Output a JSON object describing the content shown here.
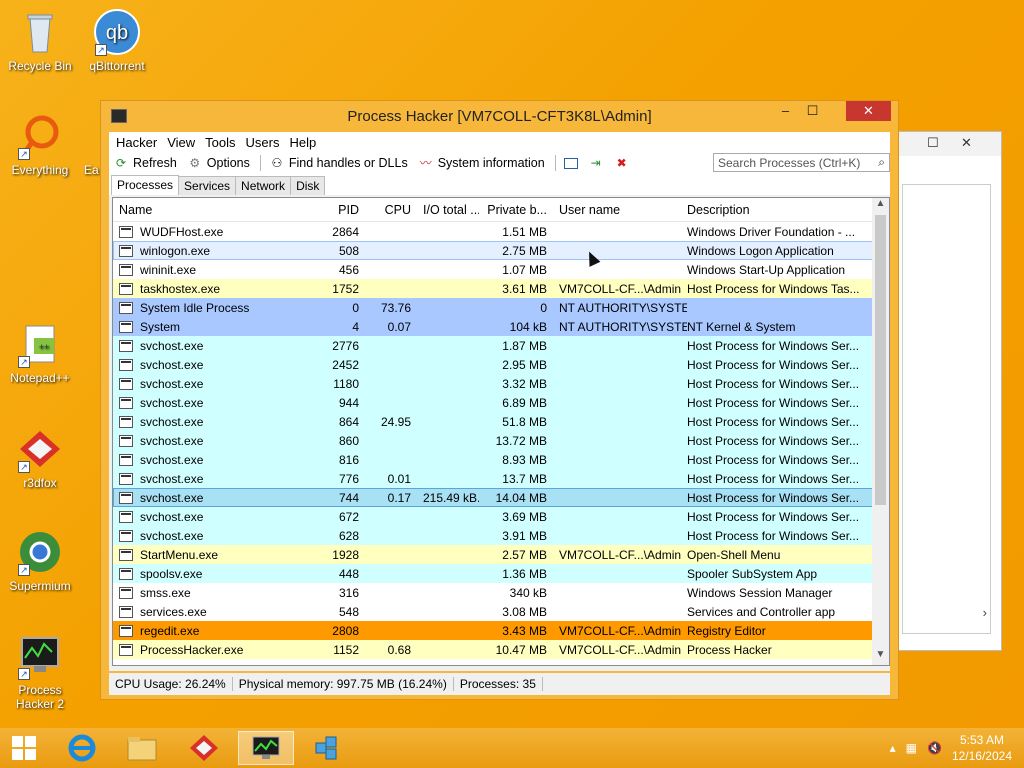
{
  "desktop": {
    "icons": [
      {
        "label": "Recycle Bin"
      },
      {
        "label": "qBittorrent"
      },
      {
        "label": "Everything"
      },
      {
        "label": "Ea"
      },
      {
        "label": "Notepad++"
      },
      {
        "label": "r3dfox"
      },
      {
        "label": "Supermium"
      },
      {
        "label": "Process Hacker 2"
      }
    ]
  },
  "window": {
    "title": "Process Hacker [VM7COLL-CFT3K8L\\Admin]",
    "menu": [
      "Hacker",
      "View",
      "Tools",
      "Users",
      "Help"
    ],
    "toolbar": {
      "refresh": "Refresh",
      "options": "Options",
      "find_handles": "Find handles or DLLs",
      "system_info": "System information"
    },
    "search_placeholder": "Search Processes (Ctrl+K)",
    "tabs": [
      "Processes",
      "Services",
      "Network",
      "Disk"
    ],
    "columns": [
      "Name",
      "PID",
      "CPU",
      "I/O total ...",
      "Private b...",
      "User name",
      "Description"
    ],
    "rows": [
      {
        "name": "WUDFHost.exe",
        "pid": "2864",
        "cpu": "",
        "io": "",
        "priv": "1.51 MB",
        "user": "",
        "desc": "Windows Driver Foundation - ...",
        "type": "normal"
      },
      {
        "name": "winlogon.exe",
        "pid": "508",
        "cpu": "",
        "io": "",
        "priv": "2.75 MB",
        "user": "",
        "desc": "Windows Logon Application",
        "type": "hover"
      },
      {
        "name": "wininit.exe",
        "pid": "456",
        "cpu": "",
        "io": "",
        "priv": "1.07 MB",
        "user": "",
        "desc": "Windows Start-Up Application",
        "type": "normal"
      },
      {
        "name": "taskhostex.exe",
        "pid": "1752",
        "cpu": "",
        "io": "",
        "priv": "3.61 MB",
        "user": "VM7COLL-CF...\\Admin",
        "desc": "Host Process for Windows Tas...",
        "type": "own"
      },
      {
        "name": "System Idle Process",
        "pid": "0",
        "cpu": "73.76",
        "io": "",
        "priv": "0",
        "user": "NT AUTHORITY\\SYSTEM",
        "desc": "",
        "type": "sys"
      },
      {
        "name": "System",
        "pid": "4",
        "cpu": "0.07",
        "io": "",
        "priv": "104 kB",
        "user": "NT AUTHORITY\\SYSTEM",
        "desc": "NT Kernel & System",
        "type": "sys"
      },
      {
        "name": "svchost.exe",
        "pid": "2776",
        "cpu": "",
        "io": "",
        "priv": "1.87 MB",
        "user": "",
        "desc": "Host Process for Windows Ser...",
        "type": "svc"
      },
      {
        "name": "svchost.exe",
        "pid": "2452",
        "cpu": "",
        "io": "",
        "priv": "2.95 MB",
        "user": "",
        "desc": "Host Process for Windows Ser...",
        "type": "svc"
      },
      {
        "name": "svchost.exe",
        "pid": "1180",
        "cpu": "",
        "io": "",
        "priv": "3.32 MB",
        "user": "",
        "desc": "Host Process for Windows Ser...",
        "type": "svc"
      },
      {
        "name": "svchost.exe",
        "pid": "944",
        "cpu": "",
        "io": "",
        "priv": "6.89 MB",
        "user": "",
        "desc": "Host Process for Windows Ser...",
        "type": "svc"
      },
      {
        "name": "svchost.exe",
        "pid": "864",
        "cpu": "24.95",
        "io": "",
        "priv": "51.8 MB",
        "user": "",
        "desc": "Host Process for Windows Ser...",
        "type": "svc"
      },
      {
        "name": "svchost.exe",
        "pid": "860",
        "cpu": "",
        "io": "",
        "priv": "13.72 MB",
        "user": "",
        "desc": "Host Process for Windows Ser...",
        "type": "svc"
      },
      {
        "name": "svchost.exe",
        "pid": "816",
        "cpu": "",
        "io": "",
        "priv": "8.93 MB",
        "user": "",
        "desc": "Host Process for Windows Ser...",
        "type": "svc"
      },
      {
        "name": "svchost.exe",
        "pid": "776",
        "cpu": "0.01",
        "io": "",
        "priv": "13.7 MB",
        "user": "",
        "desc": "Host Process for Windows Ser...",
        "type": "svc"
      },
      {
        "name": "svchost.exe",
        "pid": "744",
        "cpu": "0.17",
        "io": "215.49 kB...",
        "priv": "14.04 MB",
        "user": "",
        "desc": "Host Process for Windows Ser...",
        "type": "sel"
      },
      {
        "name": "svchost.exe",
        "pid": "672",
        "cpu": "",
        "io": "",
        "priv": "3.69 MB",
        "user": "",
        "desc": "Host Process for Windows Ser...",
        "type": "svc"
      },
      {
        "name": "svchost.exe",
        "pid": "628",
        "cpu": "",
        "io": "",
        "priv": "3.91 MB",
        "user": "",
        "desc": "Host Process for Windows Ser...",
        "type": "svc"
      },
      {
        "name": "StartMenu.exe",
        "pid": "1928",
        "cpu": "",
        "io": "",
        "priv": "2.57 MB",
        "user": "VM7COLL-CF...\\Admin",
        "desc": "Open-Shell Menu",
        "type": "own"
      },
      {
        "name": "spoolsv.exe",
        "pid": "448",
        "cpu": "",
        "io": "",
        "priv": "1.36 MB",
        "user": "",
        "desc": "Spooler SubSystem App",
        "type": "svc"
      },
      {
        "name": "smss.exe",
        "pid": "316",
        "cpu": "",
        "io": "",
        "priv": "340 kB",
        "user": "",
        "desc": "Windows Session Manager",
        "type": "normal"
      },
      {
        "name": "services.exe",
        "pid": "548",
        "cpu": "",
        "io": "",
        "priv": "3.08 MB",
        "user": "",
        "desc": "Services and Controller app",
        "type": "normal"
      },
      {
        "name": "regedit.exe",
        "pid": "2808",
        "cpu": "",
        "io": "",
        "priv": "3.43 MB",
        "user": "VM7COLL-CF...\\Admin",
        "desc": "Registry Editor",
        "type": "ele"
      },
      {
        "name": "ProcessHacker.exe",
        "pid": "1152",
        "cpu": "0.68",
        "io": "",
        "priv": "10.47 MB",
        "user": "VM7COLL-CF...\\Admin",
        "desc": "Process Hacker",
        "type": "own"
      }
    ],
    "status": {
      "cpu": "CPU Usage: 26.24%",
      "mem": "Physical memory: 997.75 MB (16.24%)",
      "procs": "Processes: 35"
    }
  },
  "taskbar": {
    "time": "5:53 AM",
    "date": "12/16/2024"
  },
  "colors": {
    "service": "#d0ffff",
    "own_process": "#ffffc0",
    "system": "#a8c8ff",
    "elevated": "#ff9900",
    "selected": "#a8e0f4"
  }
}
